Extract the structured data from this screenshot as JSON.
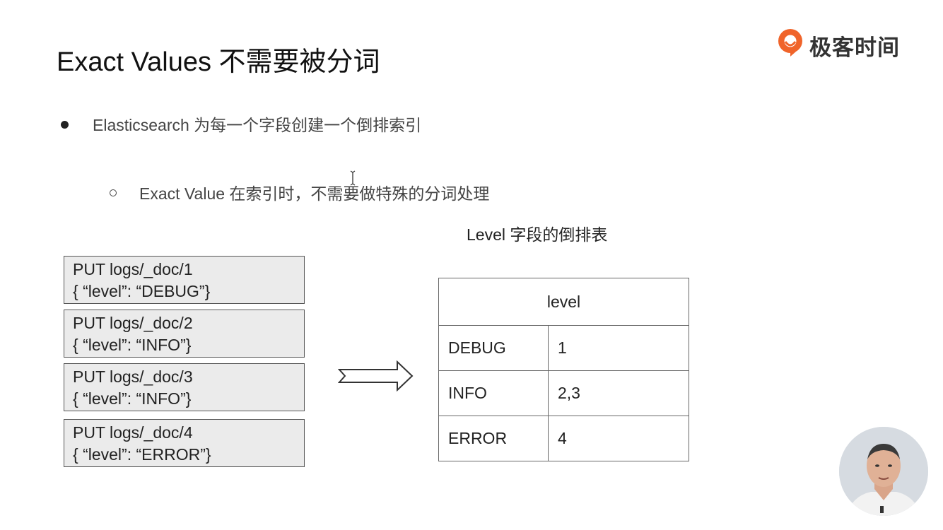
{
  "slide": {
    "title": "Exact Values 不需要被分词",
    "logo": {
      "text": "极客时间",
      "icon": "geektime-logo-icon",
      "color": "#f0642a"
    },
    "bullets": [
      {
        "text": "Elasticsearch 为每一个字段创建一个倒排索引"
      },
      {
        "text": "Exact Value 在索引时，不需要做特殊的分词处理"
      }
    ],
    "table_caption": "Level 字段的倒排表",
    "documents": [
      {
        "request": "PUT logs/_doc/1",
        "body": "{ “level”: “DEBUG”}"
      },
      {
        "request": "PUT logs/_doc/2",
        "body": "{ “level”: “INFO”}"
      },
      {
        "request": "PUT logs/_doc/3",
        "body": "{ “level”: “INFO”}"
      },
      {
        "request": "PUT logs/_doc/4",
        "body": "{ “level”: “ERROR”}"
      }
    ],
    "arrow_icon": "right-arrow-icon",
    "inverted_table": {
      "header": "level",
      "rows": [
        {
          "term": "DEBUG",
          "docs": "1"
        },
        {
          "term": "INFO",
          "docs": "2,3"
        },
        {
          "term": "ERROR",
          "docs": "4"
        }
      ]
    },
    "presenter_video": "presenter-webcam"
  }
}
